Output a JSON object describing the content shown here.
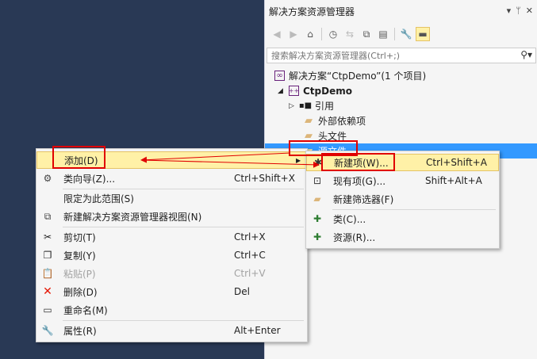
{
  "solution_explorer": {
    "title": "解决方案资源管理器",
    "title_controls": [
      "▾",
      "ᛘ",
      "✕"
    ],
    "search_placeholder": "搜索解决方案资源管理器(Ctrl+;)",
    "tree": {
      "solution": "解决方案“CtpDemo”(1 个项目)",
      "project": "CtpDemo",
      "references": "引用",
      "external_deps": "外部依赖项",
      "header_files": "头文件",
      "source_files": "源文件"
    }
  },
  "context_menu": {
    "items": [
      {
        "label": "添加(D)",
        "shortcut": ""
      },
      {
        "label": "类向导(Z)...",
        "shortcut": "Ctrl+Shift+X"
      },
      {
        "label": "限定为此范围(S)",
        "shortcut": ""
      },
      {
        "label": "新建解决方案资源管理器视图(N)",
        "shortcut": ""
      },
      {
        "label": "剪切(T)",
        "shortcut": "Ctrl+X"
      },
      {
        "label": "复制(Y)",
        "shortcut": "Ctrl+C"
      },
      {
        "label": "粘贴(P)",
        "shortcut": "Ctrl+V"
      },
      {
        "label": "删除(D)",
        "shortcut": "Del"
      },
      {
        "label": "重命名(M)",
        "shortcut": ""
      },
      {
        "label": "属性(R)",
        "shortcut": "Alt+Enter"
      }
    ]
  },
  "submenu": {
    "items": [
      {
        "label": "新建项(W)...",
        "shortcut": "Ctrl+Shift+A"
      },
      {
        "label": "现有项(G)...",
        "shortcut": "Shift+Alt+A"
      },
      {
        "label": "新建筛选器(F)",
        "shortcut": ""
      },
      {
        "label": "类(C)...",
        "shortcut": ""
      },
      {
        "label": "资源(R)...",
        "shortcut": ""
      }
    ]
  },
  "colors": {
    "highlight": "#fff1a7",
    "selection": "#3399ff",
    "annotation_red": "#e00000"
  }
}
